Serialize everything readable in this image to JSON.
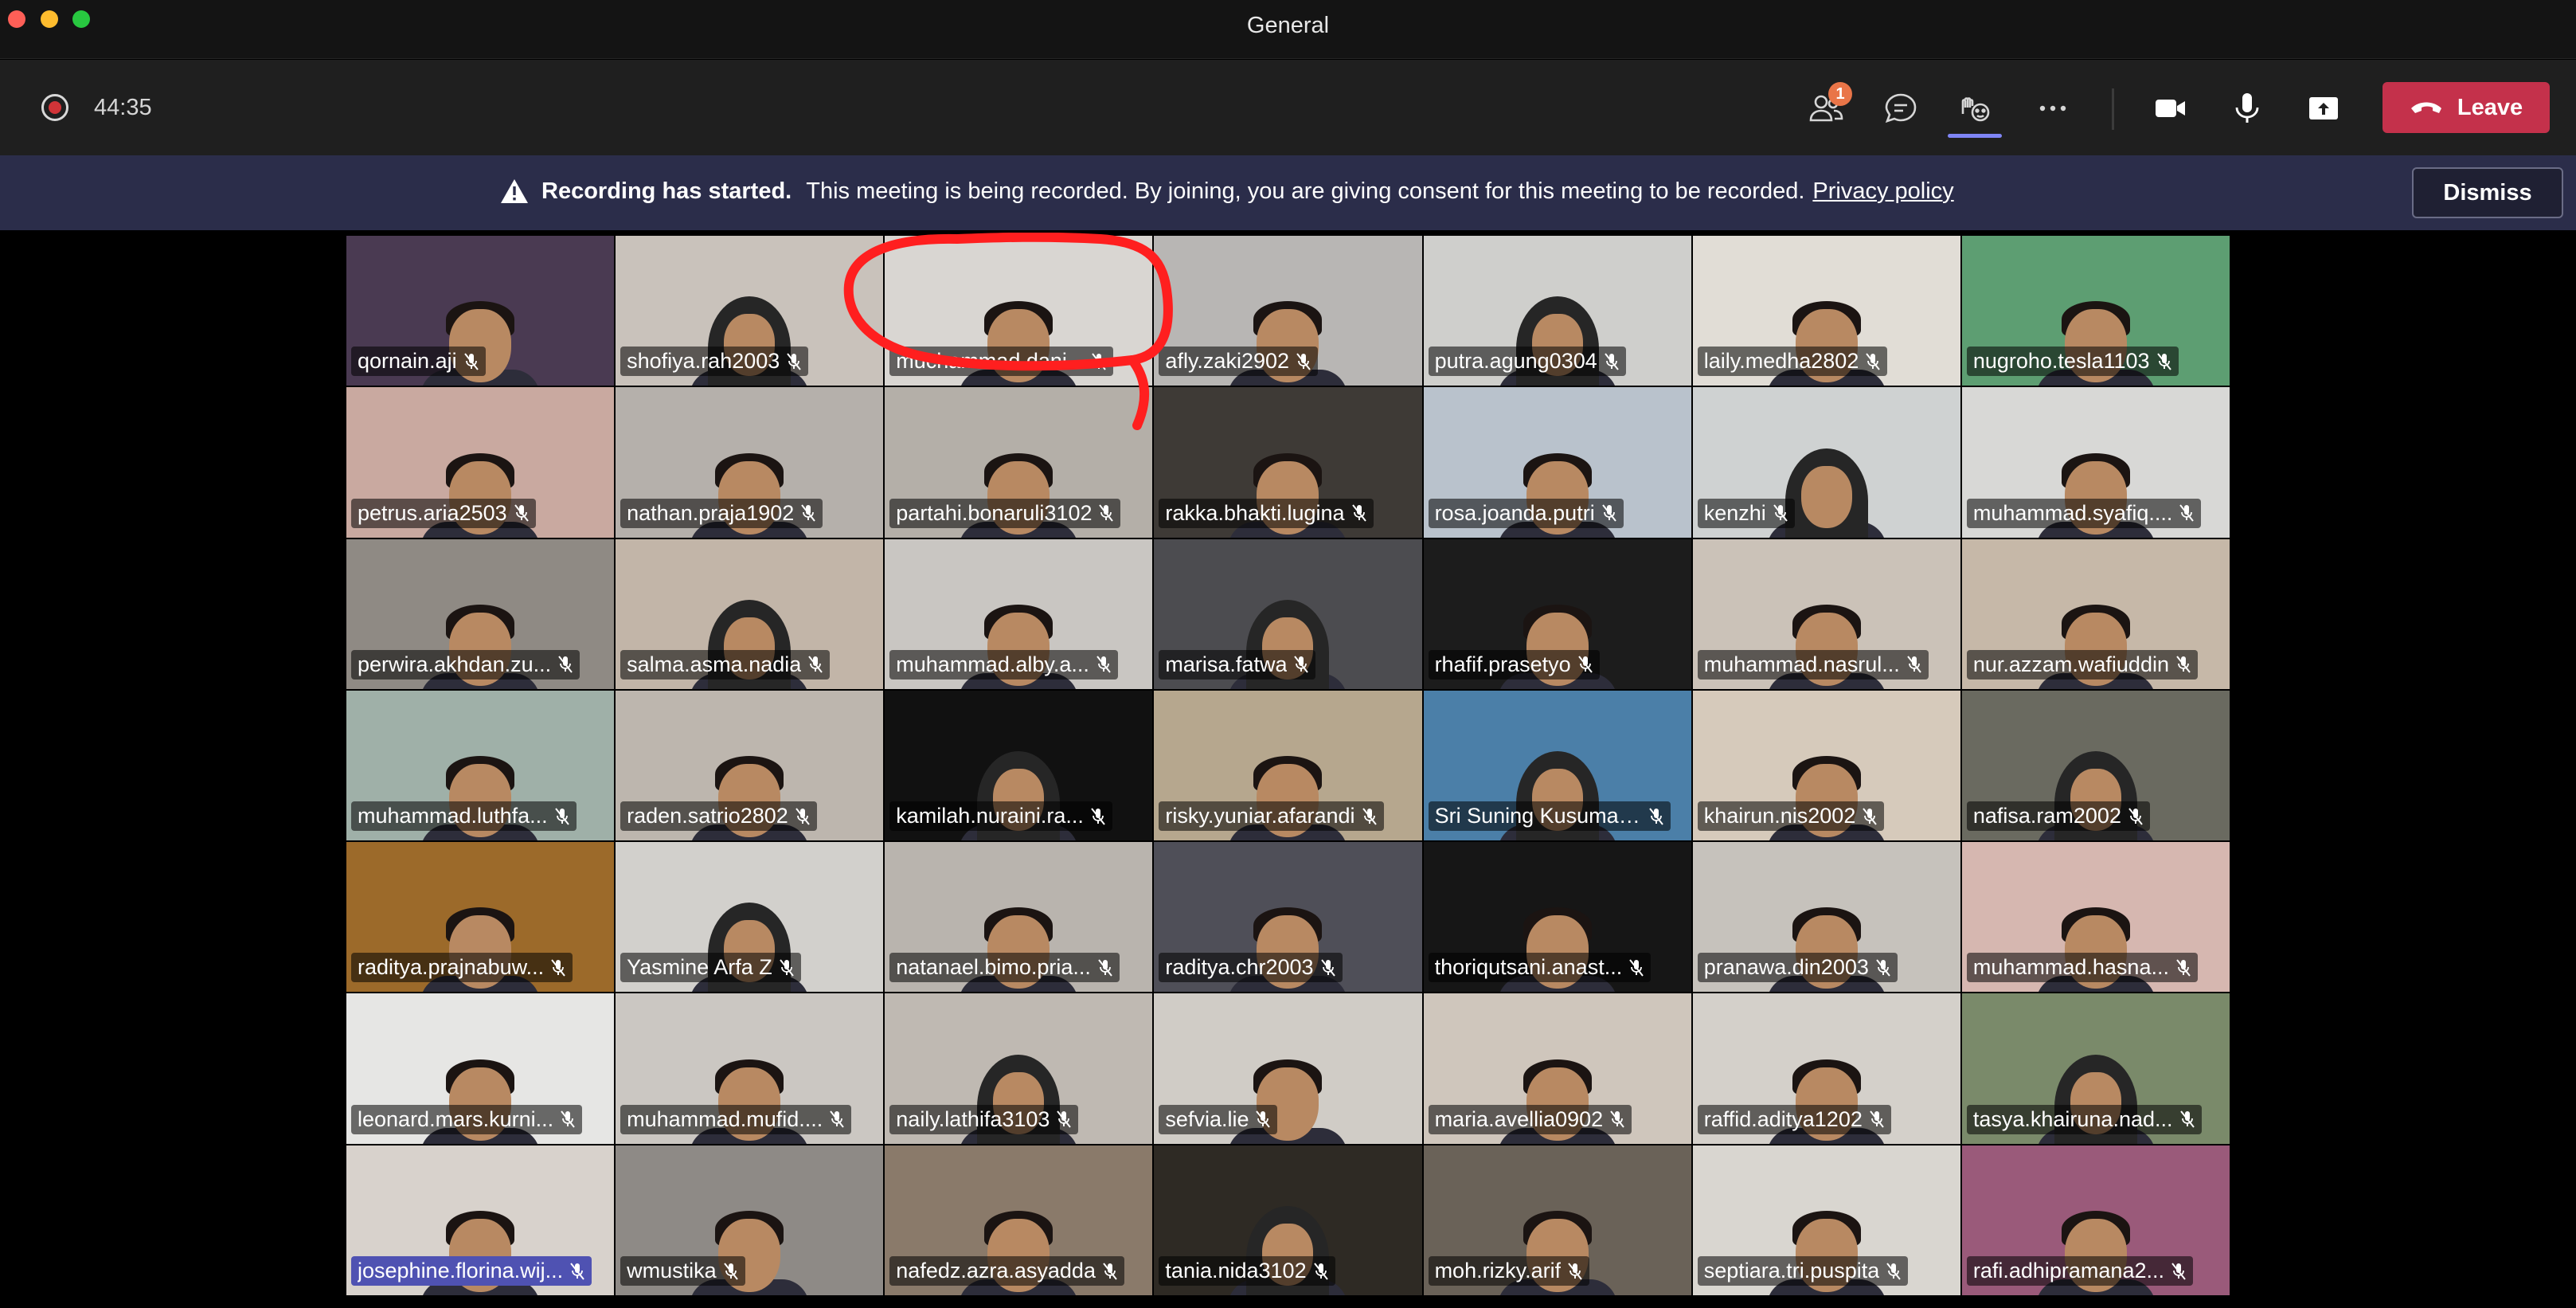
{
  "window": {
    "title": "General"
  },
  "toolbar": {
    "timer": "44:35",
    "participants_badge": "1",
    "leave_label": "Leave"
  },
  "banner": {
    "title": "Recording has started.",
    "message": "This meeting is being recorded. By joining, you are giving consent for this meeting to be recorded.",
    "link": "Privacy policy",
    "dismiss_label": "Dismiss"
  },
  "participants": [
    "qornain.aji",
    "shofiya.rah2003",
    "muchammad.dani...",
    "afly.zaki2902",
    "putra.agung0304",
    "laily.medha2802",
    "nugroho.tesla1103",
    "petrus.aria2503",
    "nathan.praja1902",
    "partahi.bonaruli3102",
    "rakka.bhakti.lugina",
    "rosa.joanda.putri",
    "kenzhi",
    "muhammad.syafiq....",
    "perwira.akhdan.zu...",
    "salma.asma.nadia",
    "muhammad.alby.a...",
    "marisa.fatwa",
    "rhafif.prasetyo",
    "muhammad.nasrul...",
    "nur.azzam.wafiuddin",
    "muhammad.luthfa...",
    "raden.satrio2802",
    "kamilah.nuraini.ra...",
    "risky.yuniar.afarandi",
    "Sri Suning Kusumaw...",
    "khairun.nis2002",
    "nafisa.ram2002",
    "raditya.prajnabuw...",
    "Yasmine Arfa Z",
    "natanael.bimo.pria...",
    "raditya.chr2003",
    "thoriqutsani.anast...",
    "pranawa.din2003",
    "muhammad.hasna...",
    "leonard.mars.kurni...",
    "muhammad.mufid....",
    "naily.lathifa3103",
    "sefvia.lie",
    "maria.avellia0902",
    "raffid.aditya1202",
    "tasya.khairuna.nad...",
    "josephine.florina.wij...",
    "wmustika",
    "nafedz.azra.asyadda",
    "tania.nida3102",
    "moh.rizky.arif",
    "septiara.tri.puspita",
    "rafi.adhipramana2..."
  ],
  "tile_backgrounds": [
    "#4a3a52",
    "#c9c2bb",
    "#d9d6d2",
    "#b8b6b4",
    "#cfcfcc",
    "#e1ddd6",
    "#5d9e72",
    "#c9a9a0",
    "#b5b0ab",
    "#b4afa8",
    "#3e3a36",
    "#b9c2cc",
    "#cfd2d2",
    "#d8d8d6",
    "#8f8a84",
    "#c2b5a8",
    "#c9c6c2",
    "#4c4c50",
    "#1c1c1c",
    "#cbc2b8",
    "#c6b8a8",
    "#9fb0a8",
    "#bdb6ae",
    "#111111",
    "#b6a78e",
    "#4b7fa8",
    "#d6cabb",
    "#6a6a60",
    "#9c6a2a",
    "#d2d0cc",
    "#b9b4ae",
    "#4f4f58",
    "#161616",
    "#c6c2bc",
    "#d6b7b0",
    "#e6e6e4",
    "#cbc7c2",
    "#bfb9b2",
    "#d0ccc6",
    "#cfc6bc",
    "#d4d0ca",
    "#7a8a6a",
    "#d8d2cc",
    "#8e8a86",
    "#8a7a6a",
    "#2e2a24",
    "#6a6258",
    "#d9d6d0",
    "#9a5a7a"
  ],
  "hijab_tiles": [
    1,
    4,
    12,
    15,
    17,
    23,
    25,
    27,
    29,
    37,
    41,
    45
  ],
  "highlighted_tile": 42
}
